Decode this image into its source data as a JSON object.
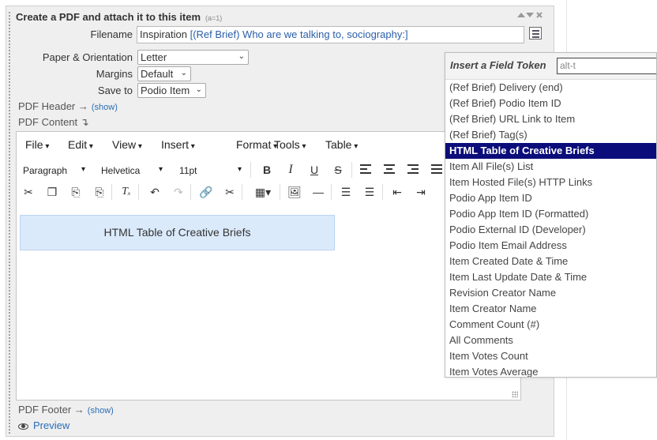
{
  "panel": {
    "title": "Create a PDF and attach it to this item",
    "title_hint": "(a=1)",
    "controls": "⇅✕"
  },
  "form": {
    "filename_label": "Filename",
    "filename_prefix": "Inspiration ",
    "filename_token": "[(Ref Brief) Who are we talking to, sociography:]",
    "paper_label": "Paper & Orientation",
    "paper_value": "Letter",
    "margins_label": "Margins",
    "margins_value": "Default",
    "saveto_label": "Save to",
    "saveto_value": "Podio Item"
  },
  "sections": {
    "header_label": "PDF Header →",
    "header_show": "(show)",
    "content_label": "PDF Content ↴",
    "footer_label": "PDF Footer →",
    "footer_show": "(show)",
    "preview": "Preview"
  },
  "editor": {
    "menus": [
      "File",
      "Edit",
      "View",
      "Insert",
      "Format",
      "Tools",
      "Table"
    ],
    "block_format": "Paragraph",
    "font_family": "Helvetica",
    "font_size": "11pt",
    "content_block": "HTML Table of Creative Briefs"
  },
  "token_panel": {
    "title": "Insert a Field Token",
    "search_value": "alt-t",
    "items": [
      "(Ref Brief) Delivery (end)",
      "(Ref Brief) Podio Item ID",
      "(Ref Brief) URL Link to Item",
      "(Ref Brief) Tag(s)",
      "HTML Table of Creative Briefs",
      "Item All File(s) List",
      "Item Hosted File(s) HTTP Links",
      "Podio App Item ID",
      "Podio App Item ID (Formatted)",
      "Podio External ID (Developer)",
      "Podio Item Email Address",
      "Item Created Date & Time",
      "Item Last Update Date & Time",
      "Revision Creator Name",
      "Item Creator Name",
      "Comment Count (#)",
      "All Comments",
      "Item Votes Count",
      "Item Votes Average"
    ],
    "selected_index": 4,
    "selected_color": "#0b0d7a"
  }
}
